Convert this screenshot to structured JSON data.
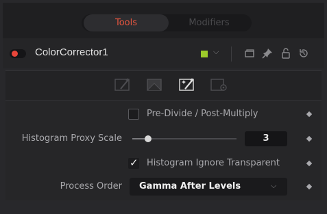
{
  "tabs": {
    "tools": "Tools",
    "modifiers": "Modifiers"
  },
  "header": {
    "tool_name": "ColorCorrector1",
    "enabled_color": "#e8463a",
    "tile_color": "#9ccb2b",
    "chevron": "⌵",
    "icons": [
      "version-icon",
      "pin-icon",
      "lock-icon",
      "reset-icon"
    ]
  },
  "icon_tabs": {
    "items": [
      "correction-tab-icon",
      "ranges-tab-icon",
      "options-tab-icon",
      "settings-tab-icon"
    ],
    "active_index": 2,
    "accent": "#e8563f"
  },
  "controls": {
    "pre_divide": {
      "label": "Pre-Divide / Post-Multiply",
      "checked": false
    },
    "histogram_proxy": {
      "label": "Histogram Proxy Scale",
      "value": "3",
      "slider_fraction": 0.15
    },
    "ignore_transparent": {
      "label": "Histogram Ignore Transparent",
      "checked": true,
      "checkmark": "✓"
    },
    "process_order": {
      "label": "Process Order",
      "value": "Gamma After Levels",
      "chevron": "⌵"
    }
  }
}
